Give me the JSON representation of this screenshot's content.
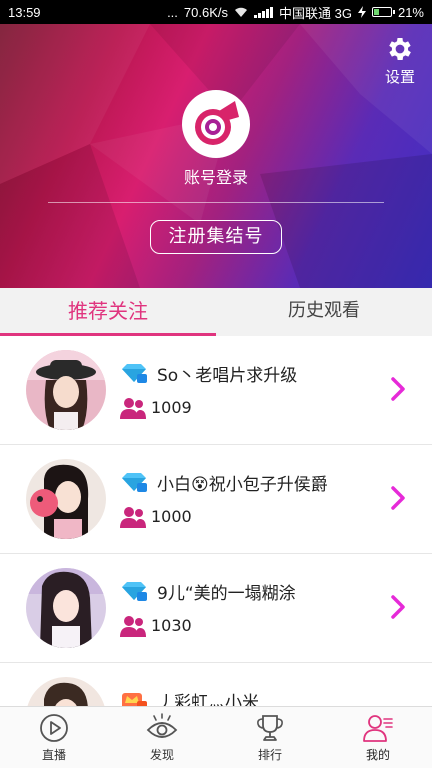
{
  "status_bar": {
    "time": "13:59",
    "dots": "...",
    "network_speed": "70.6K/s",
    "carrier": "中国联通 3G",
    "battery": "21%"
  },
  "header": {
    "settings_label": "设置",
    "login_label": "账号登录",
    "register_label": "注册集结号",
    "accent_color": "#e0347e"
  },
  "tabs": [
    {
      "label": "推荐关注",
      "active": true
    },
    {
      "label": "历史观看",
      "active": false
    }
  ],
  "streamers": [
    {
      "name": "So丶老唱片求升级",
      "followers": "1009",
      "badge": "diamond-icon"
    },
    {
      "name": "小白😵祝小包子升侯爵",
      "followers": "1000",
      "badge": "diamond-icon"
    },
    {
      "name": "9儿“美的一塌糊涂",
      "followers": "1030",
      "badge": "diamond-icon"
    },
    {
      "name": "丿彩虹灬小米",
      "followers": "",
      "badge": "crown-icon"
    }
  ],
  "bottom_nav": [
    {
      "label": "直播",
      "icon": "play-icon"
    },
    {
      "label": "发现",
      "icon": "eye-icon"
    },
    {
      "label": "排行",
      "icon": "trophy-icon"
    },
    {
      "label": "我的",
      "icon": "profile-icon",
      "active": true
    }
  ]
}
